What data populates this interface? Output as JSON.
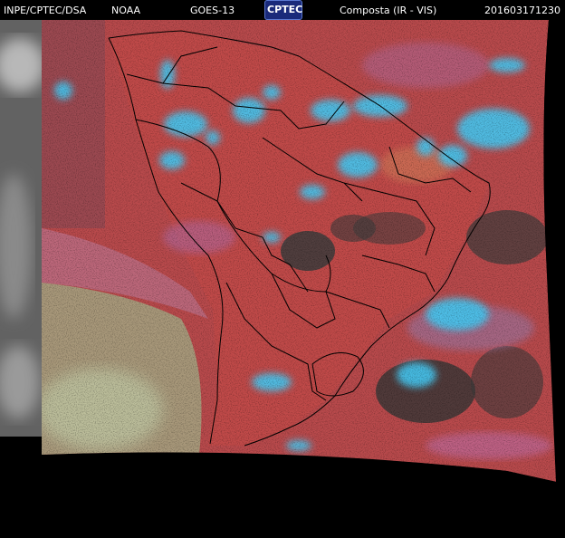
{
  "header": {
    "agency": "INPE/CPTEC/DSA",
    "provider": "NOAA",
    "satellite": "GOES-13",
    "logo_text": "CPTEC",
    "product": "Composta (IR - VIS)",
    "timestamp": "201603171230"
  },
  "colors": {
    "background": "#000000",
    "land_red": "#c24a4a",
    "ocean_red": "#b94a4c",
    "cloud_cyan": "#44c8f0",
    "cloud_pink": "#b06a9a",
    "gray_ir": "#6a6a6a",
    "green_vis": "#9fbf88",
    "dark_patch": "#3a3a3a",
    "borders": "#000000"
  }
}
